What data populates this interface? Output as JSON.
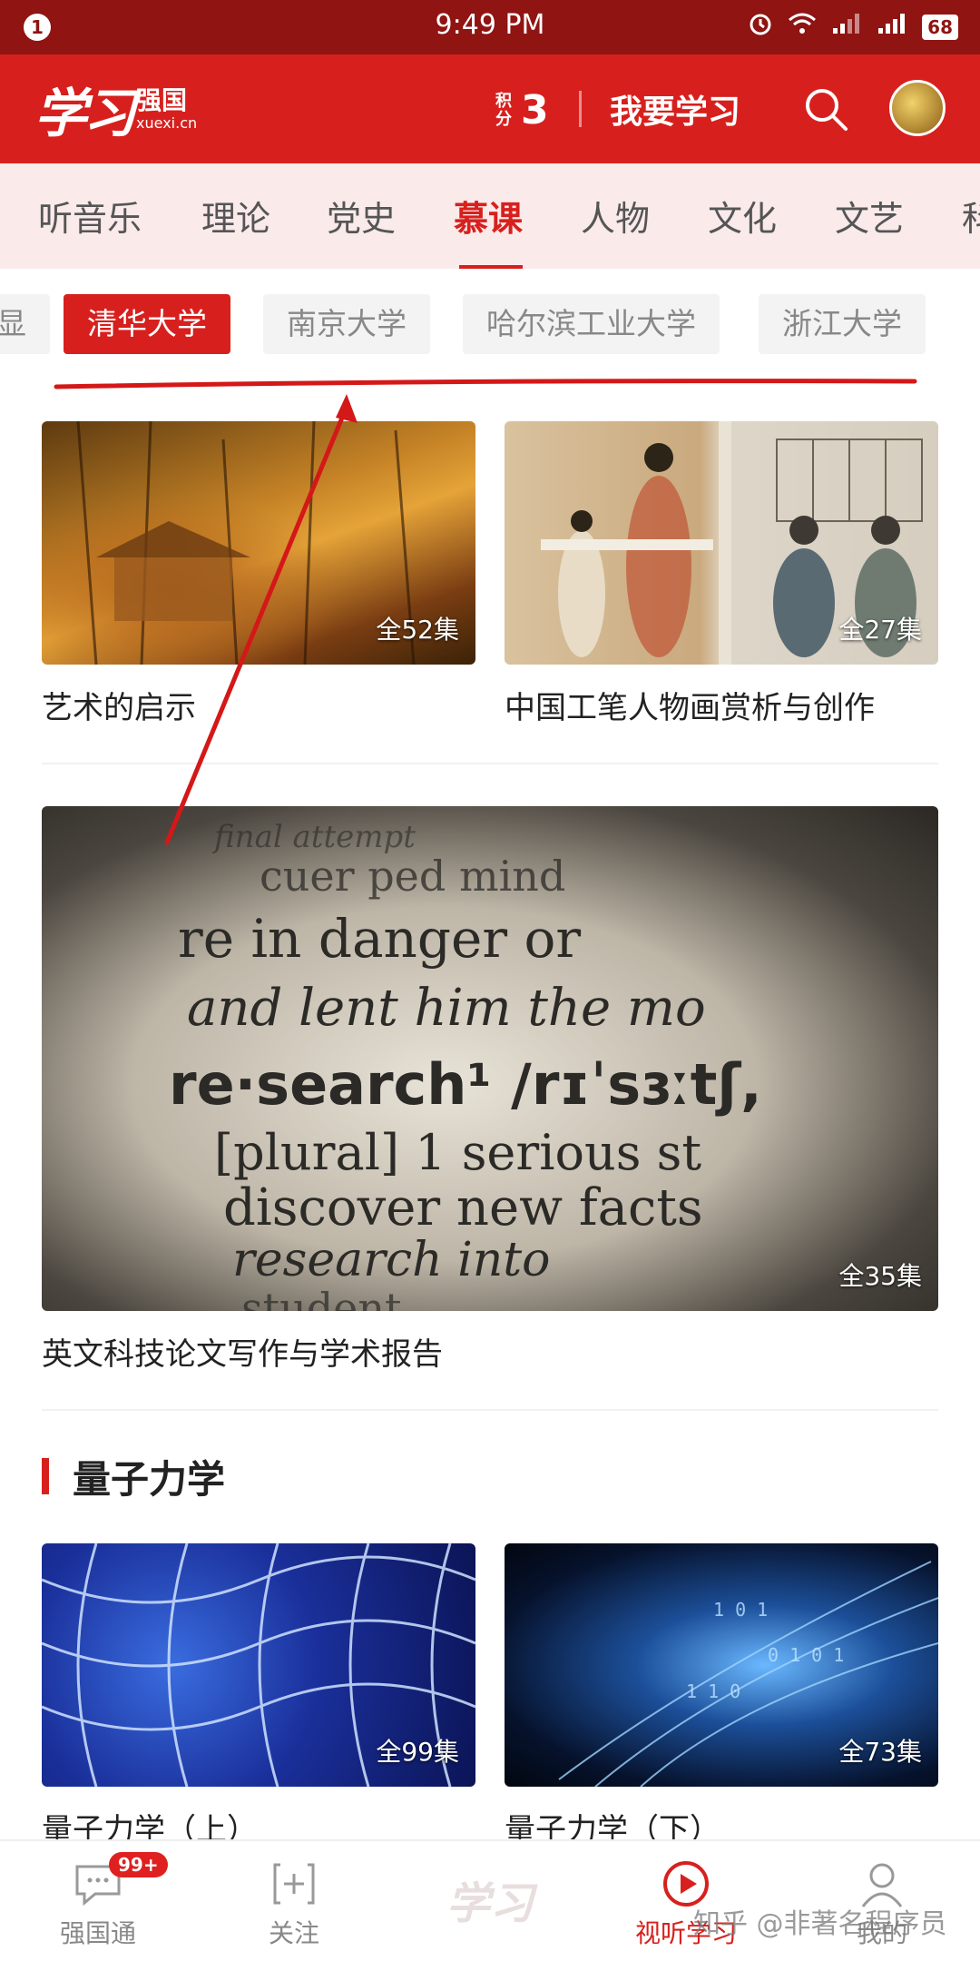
{
  "status_bar": {
    "notification_count": "1",
    "time": "9:49 PM",
    "battery": "68",
    "icons": [
      "alarm-icon",
      "wifi-icon",
      "signal-icon",
      "signal-2-icon",
      "battery-icon"
    ]
  },
  "header": {
    "logo_script": "学习",
    "logo_cn": "强国",
    "logo_en": "xuexi.cn",
    "points_label": "积分",
    "points_value": "3",
    "learn_label": "我要学习",
    "accent_color": "#d7201d"
  },
  "tabs": [
    "听音乐",
    "理论",
    "党史",
    "慕课",
    "人物",
    "文化",
    "文艺",
    "科"
  ],
  "active_tab": "慕课",
  "chips": [
    "显",
    "清华大学",
    "南京大学",
    "哈尔滨工业大学",
    "浙江大学"
  ],
  "active_chip": "清华大学",
  "courses": [
    {
      "title": "艺术的启示",
      "episodes": "全52集"
    },
    {
      "title": "中国工笔人物画赏析与创作",
      "episodes": "全27集"
    },
    {
      "title": "英文科技论文写作与学术报告",
      "episodes": "全35集"
    }
  ],
  "dictionary_lines": [
    "final attempt",
    "cuer  ped mind",
    "re  in danger or",
    "and lent him the mo",
    "re·search¹ /rɪˈsɜːtʃ,",
    "[plural]   1  serious st",
    "discover  new  facts",
    "research  into",
    "student"
  ],
  "section": {
    "title": "量子力学",
    "courses": [
      {
        "title": "量子力学（上）",
        "episodes": "全99集"
      },
      {
        "title": "量子力学（下）",
        "episodes": "全73集"
      }
    ]
  },
  "bottom_nav": {
    "items": [
      {
        "label": "强国通",
        "badge": "99+"
      },
      {
        "label": "关注"
      },
      {
        "label": "学习"
      },
      {
        "label": "视听学习"
      },
      {
        "label": "我的"
      }
    ],
    "active": "视听学习"
  },
  "watermark": "知乎 @非著名程序员"
}
